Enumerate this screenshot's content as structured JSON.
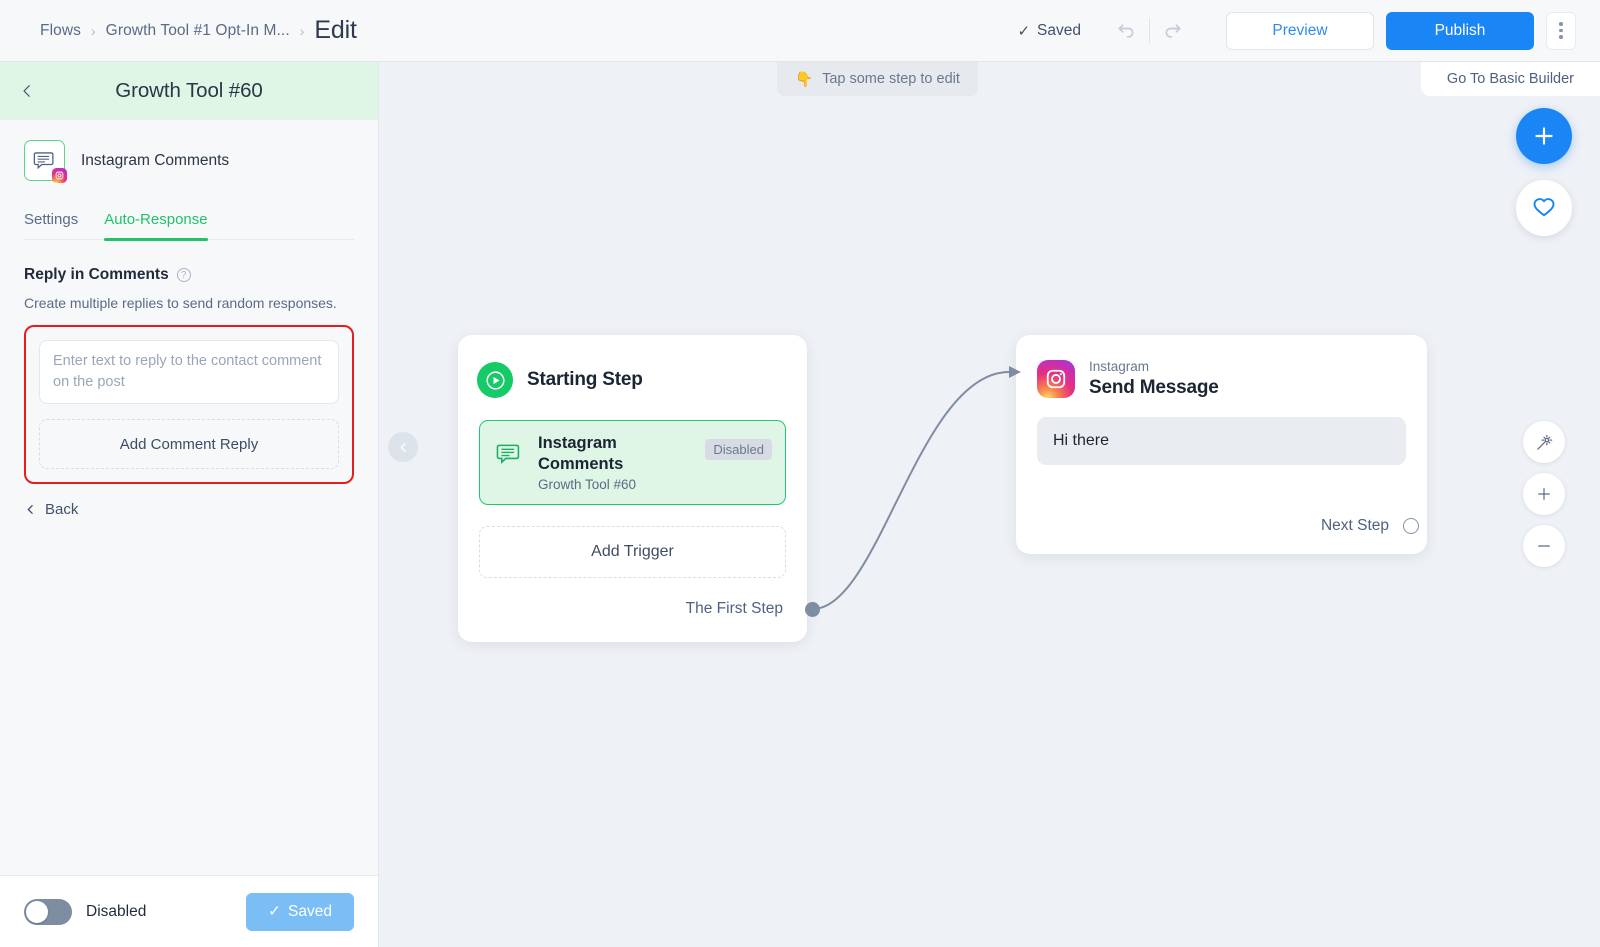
{
  "topbar": {
    "breadcrumb": [
      {
        "label": "Flows",
        "type": "link"
      },
      {
        "label": "Growth Tool #1 Opt-In M...",
        "type": "link"
      },
      {
        "label": "Edit",
        "type": "current"
      }
    ],
    "separator": "›",
    "saved_status": "Saved",
    "saved_tick": "✓",
    "undo_icon": "undo-icon",
    "redo_icon": "redo-icon",
    "preview_label": "Preview",
    "publish_label": "Publish",
    "kebab_icon": "more-vertical-icon",
    "accent_blue": "#1a85f5"
  },
  "sidebar": {
    "back_arrow": "‹",
    "title": "Growth Tool #60",
    "header_bg": "#dff6e6",
    "app_icon": "instagram-comments-icon",
    "app_name": "Instagram Comments",
    "tabs": [
      {
        "label": "Settings",
        "active": false
      },
      {
        "label": "Auto-Response",
        "active": true
      }
    ],
    "active_tab_color": "#21c268",
    "section": {
      "title": "Reply in Comments",
      "help_icon": "?",
      "subtitle": "Create multiple replies to send random responses."
    },
    "reply_input": {
      "value": "",
      "placeholder": "Enter text to reply to the contact comment on the post"
    },
    "add_reply_label": "Add Comment Reply",
    "highlight_color": "#e81c1c",
    "back_label": "Back",
    "back_chevron": "‹",
    "footer": {
      "toggle_state": "off",
      "toggle_label": "Disabled",
      "saved_button_label": "Saved",
      "saved_button_tick": "✓"
    }
  },
  "canvas": {
    "hint_emoji": "👇",
    "hint_text": "Tap some step to edit",
    "basic_builder_label": "Go To Basic Builder",
    "collapse_icon": "chevron-left-icon",
    "fab_add_icon": "plus-icon",
    "fab_heart_icon": "heart-icon",
    "zoom_controls": [
      {
        "name": "magic-wand-icon"
      },
      {
        "name": "zoom-in-icon",
        "glyph": "+"
      },
      {
        "name": "zoom-out-icon",
        "glyph": "−"
      }
    ],
    "nodes": [
      {
        "id": "starting-step",
        "title": "Starting Step",
        "icon": "play-circle-icon",
        "trigger": {
          "icon": "comments-icon",
          "name": "Instagram Comments",
          "subtitle": "Growth Tool #60",
          "badge": "Disabled"
        },
        "add_trigger_label": "Add Trigger",
        "port_label": "The First Step"
      },
      {
        "id": "send-message",
        "app": "Instagram",
        "title": "Send Message",
        "icon": "instagram-icon",
        "message": "Hi there",
        "port_label": "Next Step"
      }
    ],
    "connection": {
      "from": "The First Step",
      "to": "Send Message",
      "color": "#7f8da3"
    }
  }
}
